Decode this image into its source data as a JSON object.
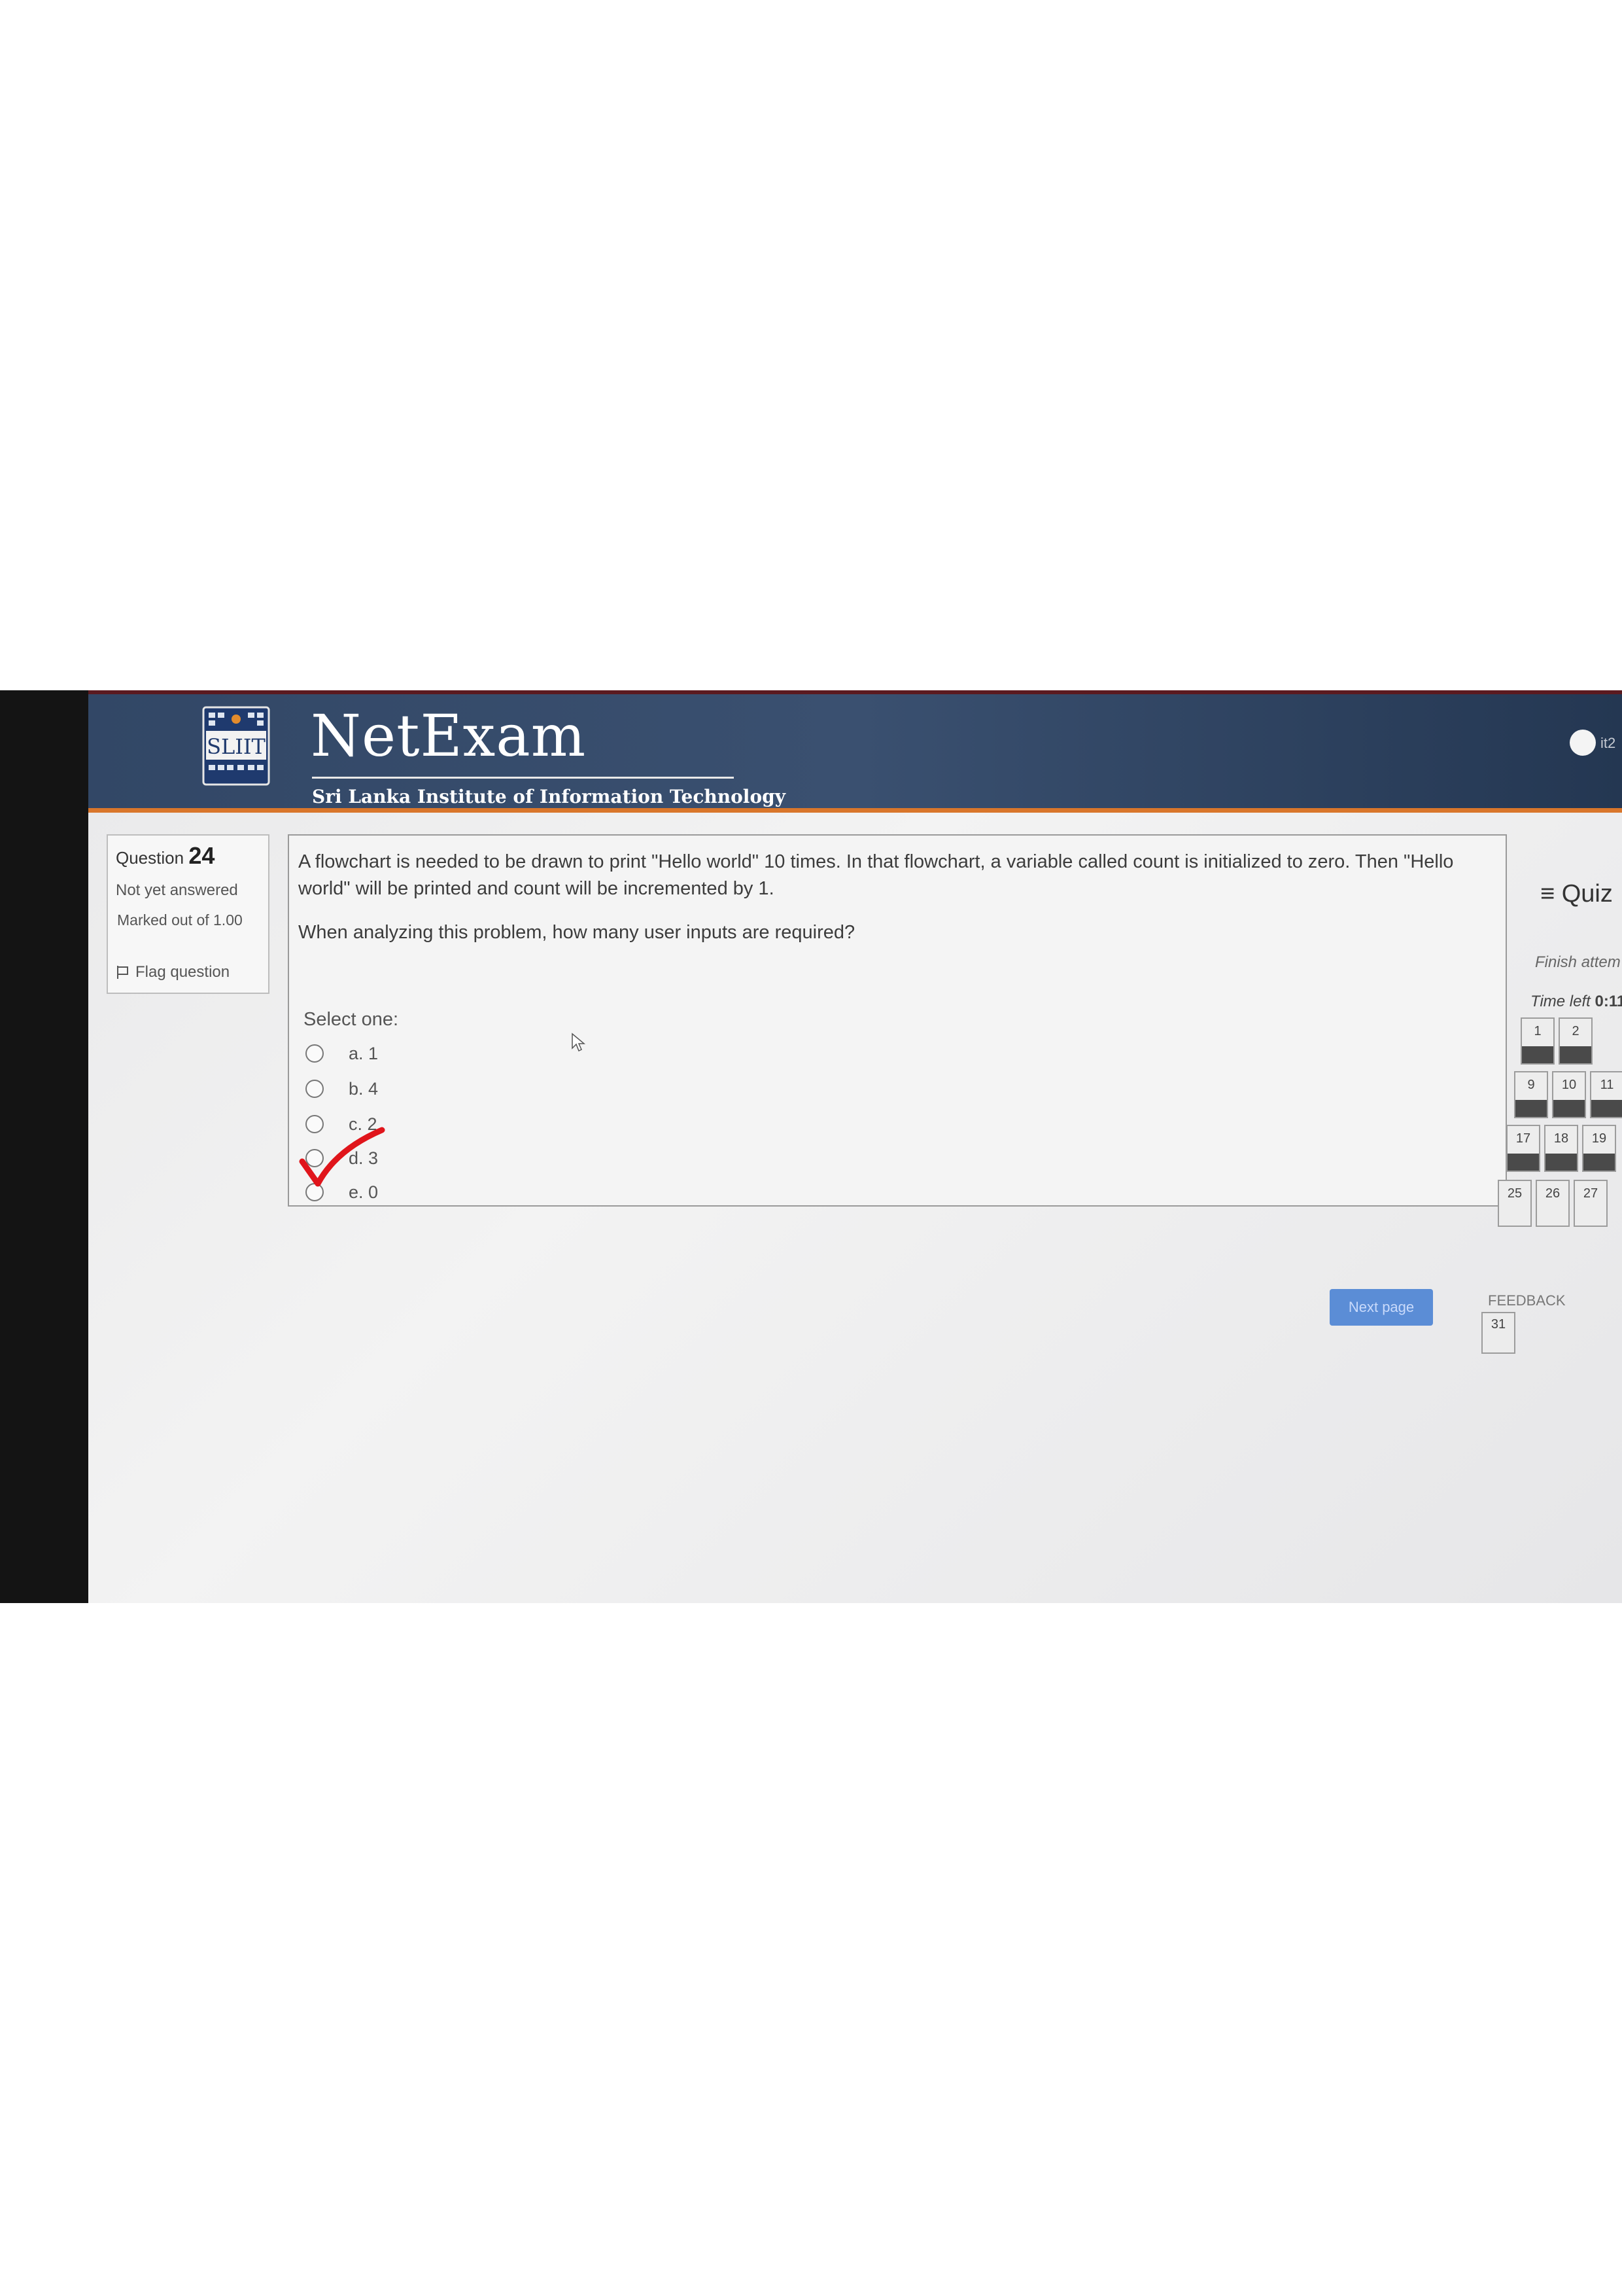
{
  "header": {
    "title": "NetExam",
    "subtitle": "Sri Lanka Institute of Information Technology",
    "logo_text": "SLIIT",
    "user": "it2"
  },
  "question_info": {
    "label": "Question",
    "number": "24",
    "state": "Not yet answered",
    "mark": "Marked out of 1.00",
    "flag": "Flag question"
  },
  "question": {
    "text": "A flowchart is needed to be drawn to print \"Hello world\" 10 times. In that flowchart, a variable called count is initialized to zero. Then \"Hello world\" will be printed and count will be incremented by 1.",
    "prompt": "When analyzing this problem, how many user inputs are required?",
    "select_label": "Select one:",
    "options": [
      {
        "label": "a. 1"
      },
      {
        "label": "b. 4"
      },
      {
        "label": "c. 2"
      },
      {
        "label": "d. 3"
      },
      {
        "label": "e. 0"
      }
    ],
    "annotation_color": "#e0151b"
  },
  "actions": {
    "next": "Next page"
  },
  "quiz_navigation": {
    "title": "≡ Quiz",
    "finish": "Finish attem",
    "time_label": "Time left",
    "time_value": "0:11",
    "buttons": [
      "1",
      "2",
      "9",
      "10",
      "11",
      "17",
      "18",
      "19",
      "25",
      "26",
      "27"
    ],
    "feedback_label": "FEEDBACK",
    "feedback_button": "31"
  },
  "colors": {
    "header": "#324766",
    "accent": "#d9762b",
    "button": "#5b8dd6"
  }
}
